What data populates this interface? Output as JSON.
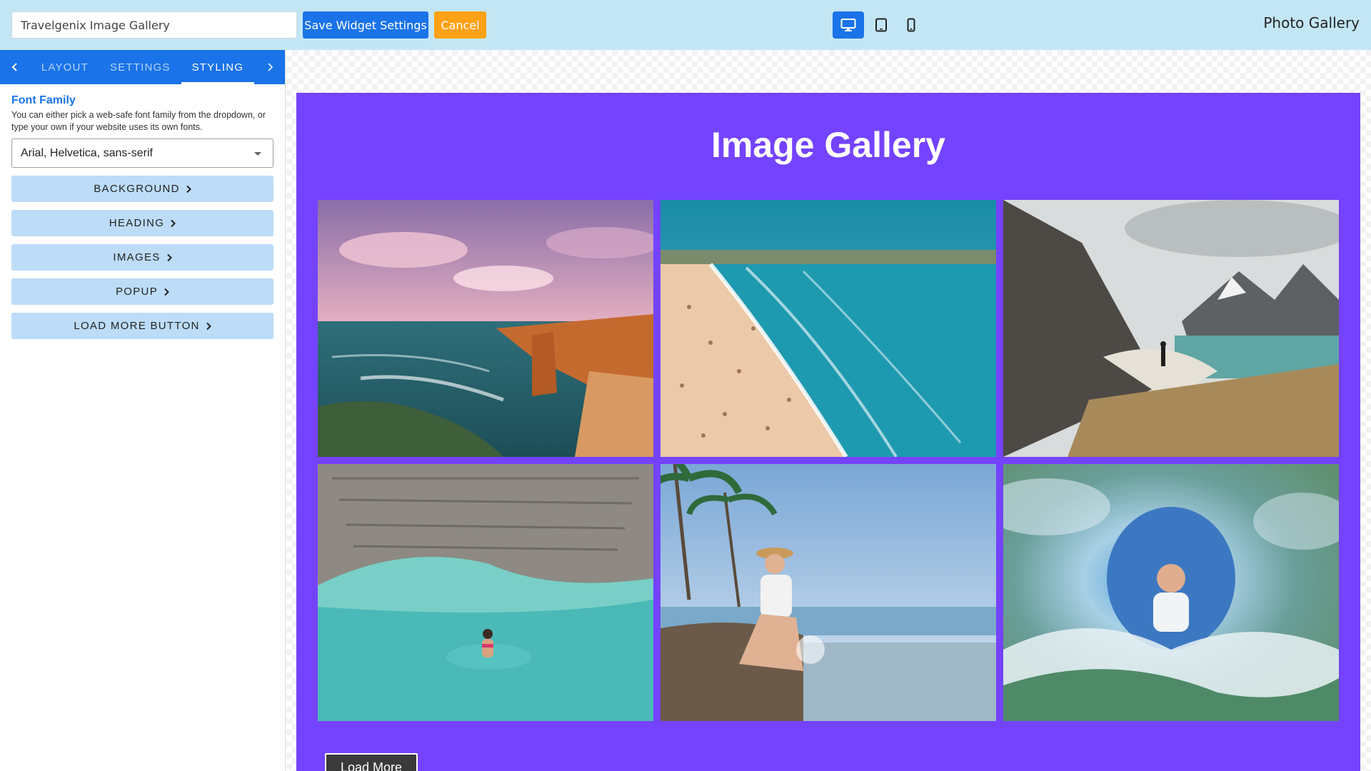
{
  "topbar": {
    "widget_name_value": "Travelgenix Image Gallery",
    "save_label": "Save Widget Settings",
    "cancel_label": "Cancel",
    "devices": [
      "desktop-icon",
      "tablet-icon",
      "mobile-icon"
    ],
    "active_device": "desktop",
    "app_title": "Photo Gallery"
  },
  "sidebar": {
    "tabs": [
      {
        "label": "LAYOUT"
      },
      {
        "label": "SETTINGS"
      },
      {
        "label": "STYLING",
        "active": true
      }
    ],
    "font_family": {
      "title": "Font Family",
      "help": "You can either pick a web-safe font family from the dropdown, or type your own if your website uses its own fonts.",
      "selected": "Arial, Helvetica, sans-serif"
    },
    "sections": [
      {
        "label": "BACKGROUND"
      },
      {
        "label": "HEADING"
      },
      {
        "label": "IMAGES"
      },
      {
        "label": "POPUP"
      },
      {
        "label": "LOAD MORE BUTTON"
      }
    ]
  },
  "preview": {
    "heading": "Image Gallery",
    "background_color": "#7443ff",
    "images": [
      {
        "name": "coastal-cliffs-sunset"
      },
      {
        "name": "crowded-beach"
      },
      {
        "name": "mountain-fjord-hiker"
      },
      {
        "name": "turquoise-lagoon-swimmer"
      },
      {
        "name": "tropical-beach-woman"
      },
      {
        "name": "underwater-wave-surfer"
      }
    ],
    "load_more_label": "Load More"
  },
  "colors": {
    "topbar": "#c3e6f5",
    "primary": "#1a73e8",
    "cancel": "#ffa114",
    "section_button": "#bcdcf8"
  }
}
